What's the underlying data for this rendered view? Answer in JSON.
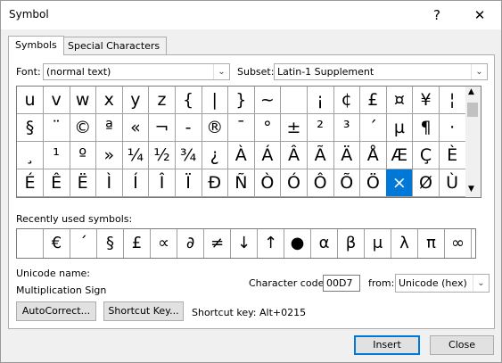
{
  "window": {
    "title": "Symbol",
    "help_glyph": "?",
    "close_glyph": "✕"
  },
  "tabs": [
    {
      "label": "Symbols",
      "active": true
    },
    {
      "label": "Special Characters",
      "active": false
    }
  ],
  "font": {
    "label": "Font:",
    "value": "(normal text)"
  },
  "subset": {
    "label": "Subset:",
    "value": "Latin-1 Supplement"
  },
  "symbol_grid": {
    "rows": [
      [
        "u",
        "v",
        "w",
        "x",
        "y",
        "z",
        "{",
        "|",
        "}",
        "~",
        "",
        "¡",
        "¢",
        "£",
        "¤",
        "¥",
        "¦"
      ],
      [
        "§",
        "¨",
        "©",
        "ª",
        "«",
        "¬",
        "-",
        "®",
        "¯",
        "°",
        "±",
        "²",
        "³",
        "´",
        "µ",
        "¶",
        "·"
      ],
      [
        "¸",
        "¹",
        "º",
        "»",
        "¼",
        "½",
        "¾",
        "¿",
        "À",
        "Á",
        "Â",
        "Ã",
        "Ä",
        "Å",
        "Æ",
        "Ç",
        "È"
      ],
      [
        "É",
        "Ê",
        "Ë",
        "Ì",
        "Í",
        "Î",
        "Ï",
        "Ð",
        "Ñ",
        "Ò",
        "Ó",
        "Ô",
        "Õ",
        "Ö",
        "×",
        "Ø",
        "Ù"
      ]
    ],
    "selected": "×"
  },
  "recent": {
    "label": "Recently used symbols:",
    "symbols": [
      "",
      "€",
      "´",
      "§",
      "£",
      "∝",
      "∂",
      "≠",
      "↓",
      "↑",
      "●",
      "α",
      "β",
      "μ",
      "λ",
      "π",
      "∞"
    ]
  },
  "unicode": {
    "name_label": "Unicode name:",
    "name_value": "Multiplication Sign"
  },
  "character_code": {
    "label": "Character code:",
    "value": "00D7",
    "from_label": "from:",
    "from_value": "Unicode (hex)"
  },
  "buttons": {
    "autocorrect": "AutoCorrect...",
    "shortcut_key": "Shortcut Key...",
    "insert": "Insert",
    "close": "Close"
  },
  "shortcut_text": "Shortcut key: Alt+0215",
  "colors": {
    "selected_bg": "#0078d7",
    "default_button_border": "#0078d7"
  }
}
